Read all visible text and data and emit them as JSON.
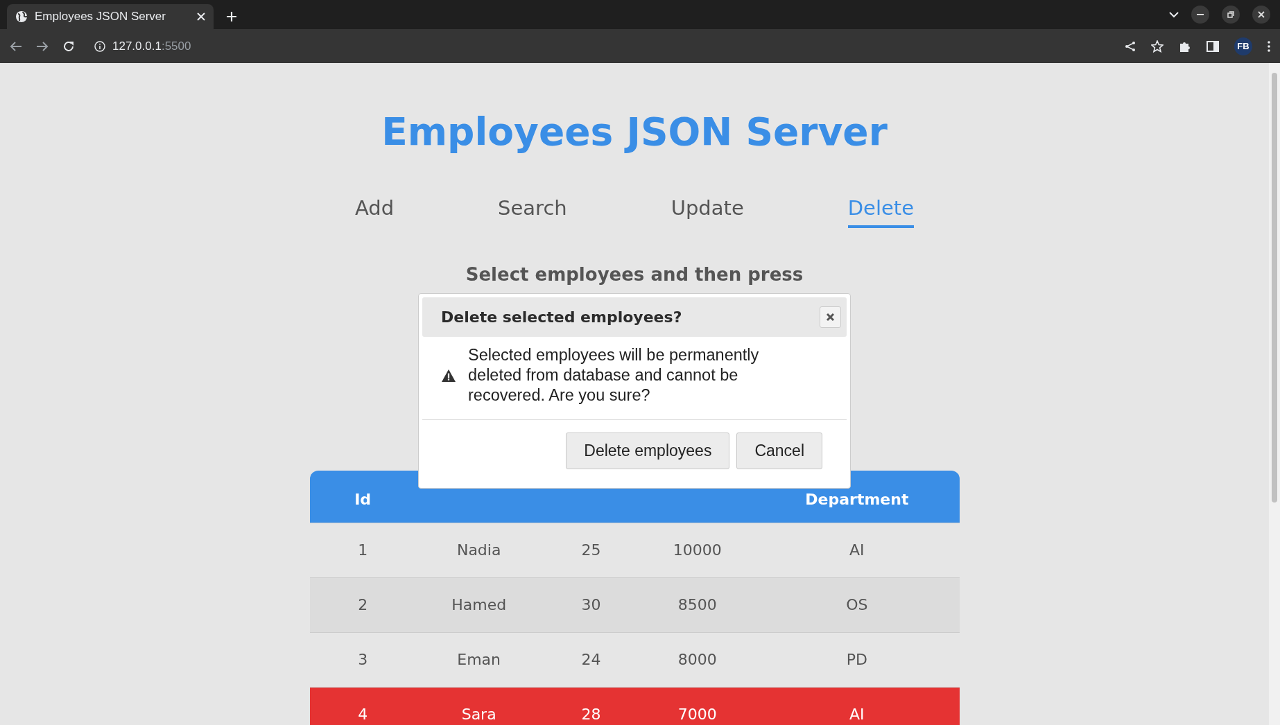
{
  "browser": {
    "tab_title": "Employees JSON Server",
    "url_host": "127.0.0.1",
    "url_port": ":5500",
    "profile": "FB"
  },
  "page": {
    "title": "Employees JSON Server",
    "nav": [
      {
        "label": "Add",
        "selected": false
      },
      {
        "label": "Search",
        "selected": false
      },
      {
        "label": "Update",
        "selected": false
      },
      {
        "label": "Delete",
        "selected": true
      }
    ],
    "instruction": "Select employees and then press"
  },
  "table": {
    "columns": [
      "Id",
      null,
      null,
      null,
      "Department"
    ],
    "rows": [
      {
        "cells": [
          "1",
          "Nadia",
          "25",
          "10000",
          "AI"
        ],
        "selected": false
      },
      {
        "cells": [
          "2",
          "Hamed",
          "30",
          "8500",
          "OS"
        ],
        "selected": false
      },
      {
        "cells": [
          "3",
          "Eman",
          "24",
          "8000",
          "PD"
        ],
        "selected": false
      },
      {
        "cells": [
          "4",
          "Sara",
          "28",
          "7000",
          "AI"
        ],
        "selected": true
      }
    ]
  },
  "dialog": {
    "title": "Delete selected employees?",
    "message": "Selected employees will be permanently deleted from database and cannot be recovered. Are you sure?",
    "buttons": [
      "Delete employees",
      "Cancel"
    ]
  }
}
